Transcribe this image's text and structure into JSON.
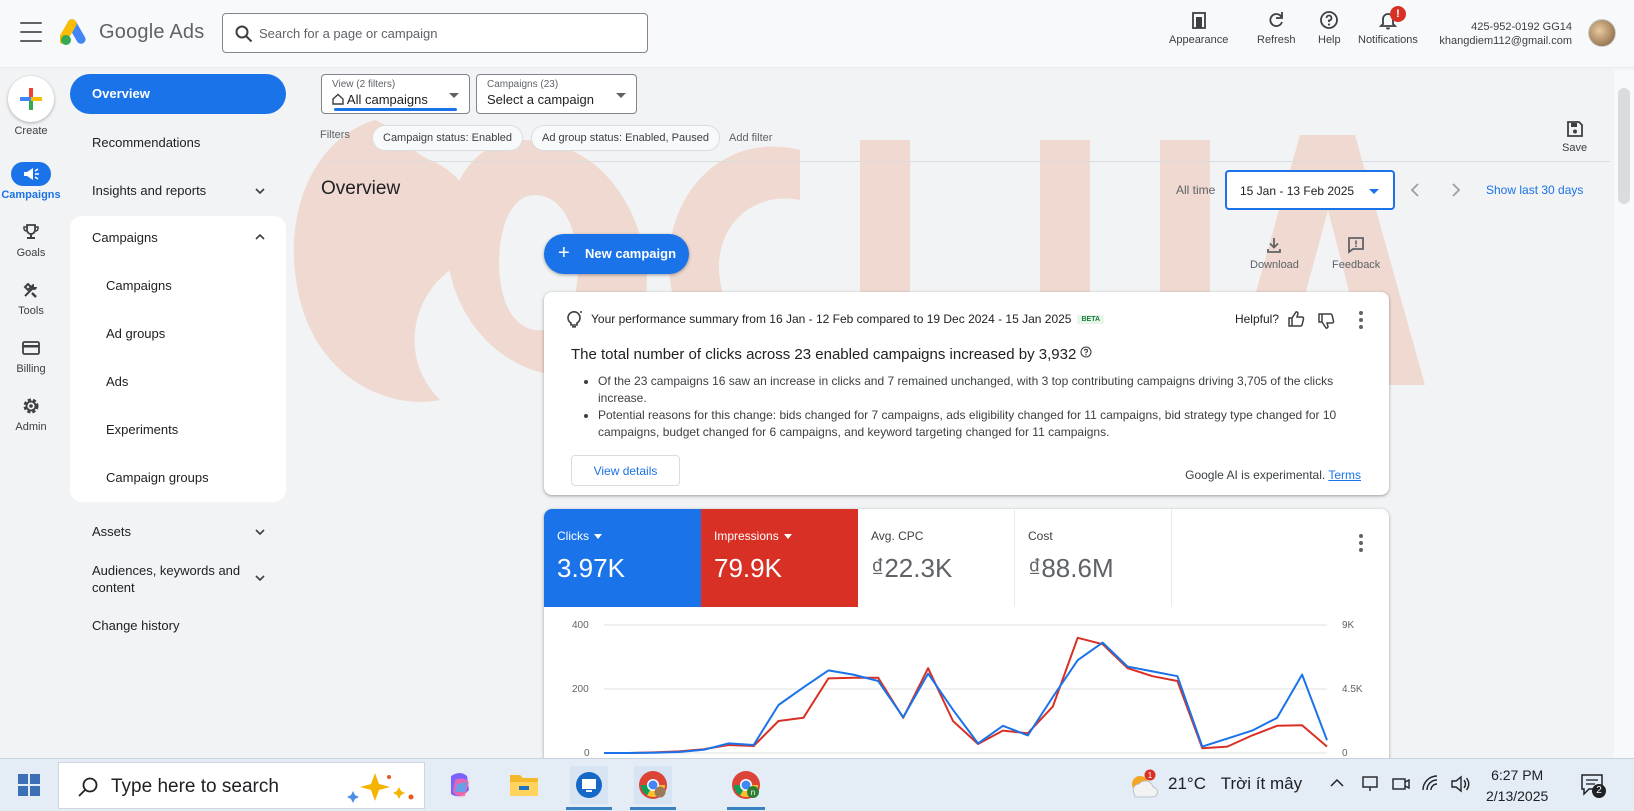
{
  "topbar": {
    "brand": "Google Ads",
    "search_placeholder": "Search for a page or campaign",
    "buttons": {
      "appearance": "Appearance",
      "refresh": "Refresh",
      "help": "Help",
      "notifications": "Notifications"
    },
    "notification_count": "!",
    "account_id": "425-952-0192 GG14",
    "account_email": "khangdiem112@gmail.com"
  },
  "rail": {
    "create": "Create",
    "items": [
      "Campaigns",
      "Goals",
      "Tools",
      "Billing",
      "Admin"
    ],
    "active": "Campaigns"
  },
  "sidenav": {
    "overview": "Overview",
    "recommendations": "Recommendations",
    "insights": "Insights and reports",
    "campaigns_group": "Campaigns",
    "sub_items": [
      "Campaigns",
      "Ad groups",
      "Ads",
      "Experiments",
      "Campaign groups"
    ],
    "assets": "Assets",
    "audiences": "Audiences, keywords and content",
    "change_history": "Change history"
  },
  "filters": {
    "view_label": "View (2 filters)",
    "view_value": "All campaigns",
    "campaigns_label": "Campaigns (23)",
    "campaigns_value": "Select a campaign",
    "filters_label": "Filters",
    "chips": [
      "Campaign status: Enabled",
      "Ad group status: Enabled, Paused"
    ],
    "add_filter": "Add filter",
    "save": "Save"
  },
  "overview": {
    "title": "Overview",
    "all_time": "All time",
    "date_range": "15 Jan - 13 Feb 2025",
    "show_last": "Show last 30 days",
    "new_campaign": "New campaign",
    "download": "Download",
    "feedback": "Feedback"
  },
  "summary": {
    "heading": "Your performance summary from 16 Jan - 12 Feb compared to 19 Dec 2024 - 15 Jan 2025",
    "beta": "BETA",
    "helpful": "Helpful?",
    "title": "The total number of clicks across 23 enabled campaigns increased by 3,932",
    "bullets": [
      "Of the 23 campaigns 16 saw an increase in clicks and 7 remained unchanged, with 3 top contributing campaigns driving 3,705 of the clicks increase.",
      "Potential reasons for this change: bids changed for 7 campaigns, ads eligibility changed for 11 campaigns, bid strategy type changed for 10 campaigns, budget changed for 6 campaigns, and keyword targeting changed for 11 campaigns."
    ],
    "view_details": "View details",
    "ai_note": "Google AI is experimental.",
    "terms": "Terms"
  },
  "metrics": [
    {
      "label": "Clicks",
      "value": "3.97K",
      "color": "#1a73e8"
    },
    {
      "label": "Impressions",
      "value": "79.9K",
      "color": "#d93025"
    },
    {
      "label": "Avg. CPC",
      "value": "₫22.3K"
    },
    {
      "label": "Cost",
      "value": "₫88.6M"
    }
  ],
  "chart_data": {
    "type": "line",
    "left_ticks": [
      "400",
      "200",
      "0"
    ],
    "right_ticks": [
      "9K",
      "4.5K",
      "0"
    ],
    "ylim_left": [
      0,
      400
    ],
    "ylim_right": [
      0,
      9000
    ],
    "series": [
      {
        "name": "Clicks",
        "color": "#1a73e8",
        "values": [
          0,
          0,
          1,
          3,
          10,
          30,
          25,
          150,
          205,
          258,
          245,
          225,
          112,
          248,
          135,
          30,
          85,
          55,
          175,
          290,
          345,
          270,
          255,
          240,
          20,
          45,
          70,
          110,
          245,
          40
        ]
      },
      {
        "name": "Impressions",
        "color": "#d93025",
        "values": [
          0,
          0,
          2,
          5,
          12,
          25,
          22,
          100,
          110,
          233,
          235,
          235,
          110,
          265,
          100,
          28,
          70,
          62,
          145,
          360,
          340,
          265,
          240,
          225,
          15,
          20,
          55,
          85,
          87,
          20
        ]
      }
    ]
  },
  "taskbar": {
    "search": "Type here to search",
    "weather_temp": "21°C",
    "weather_text": "Trời ít mây",
    "time": "6:27 PM",
    "date": "2/13/2025",
    "notif_count": "2"
  }
}
